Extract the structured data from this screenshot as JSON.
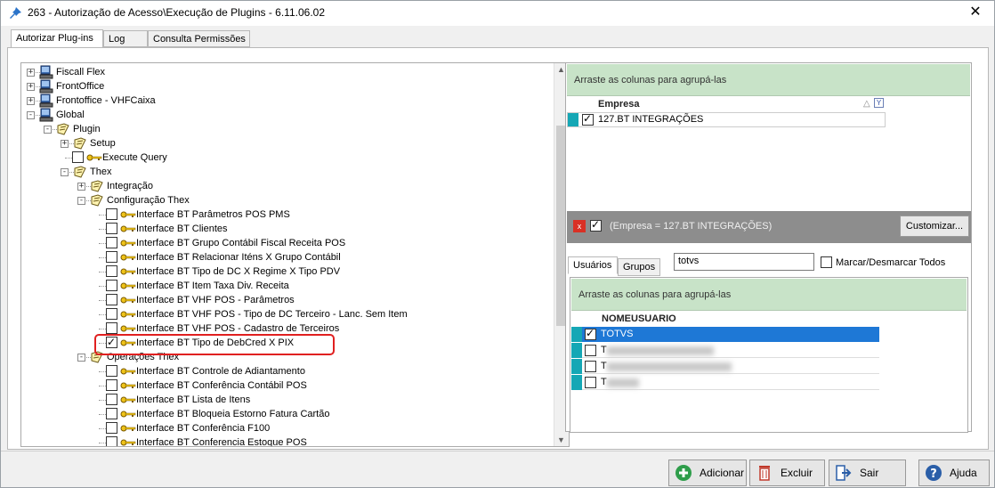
{
  "window": {
    "title": "263 - Autorização de Acesso\\Execução de Plugins - 6.11.06.02",
    "close_glyph": "✕"
  },
  "tabs": [
    "Autorizar Plug-ins",
    "Log",
    "Consulta Permissões"
  ],
  "tree": {
    "nodes": [
      {
        "label": "Fiscall Flex",
        "type": "server"
      },
      {
        "label": "FrontOffice",
        "type": "server"
      },
      {
        "label": "Frontoffice - VHFCaixa",
        "type": "server"
      },
      {
        "label": "Global",
        "type": "server"
      },
      {
        "label": "Plugin",
        "type": "folder"
      },
      {
        "label": "Setup",
        "type": "folder"
      },
      {
        "label": "Execute Query",
        "type": "item",
        "checked": false
      },
      {
        "label": "Thex",
        "type": "folder"
      },
      {
        "label": "Integração",
        "type": "folder"
      },
      {
        "label": "Configuração Thex",
        "type": "folder"
      },
      {
        "label": "Interface BT Parâmetros POS PMS",
        "type": "item",
        "checked": false
      },
      {
        "label": "Interface BT Clientes",
        "type": "item",
        "checked": false
      },
      {
        "label": "Interface BT Grupo Contábil Fiscal Receita POS",
        "type": "item",
        "checked": false
      },
      {
        "label": "Interface BT Relacionar Iténs X Grupo Contábil",
        "type": "item",
        "checked": false
      },
      {
        "label": "Interface BT Tipo de DC X Regime X Tipo PDV",
        "type": "item",
        "checked": false
      },
      {
        "label": "Interface BT Item Taxa Div. Receita",
        "type": "item",
        "checked": false
      },
      {
        "label": "Interface BT VHF POS - Parâmetros",
        "type": "item",
        "checked": false
      },
      {
        "label": "Interface BT VHF POS - Tipo de DC Terceiro - Lanc. Sem Item",
        "type": "item",
        "checked": false
      },
      {
        "label": "Interface BT VHF POS - Cadastro de Terceiros",
        "type": "item",
        "checked": false
      },
      {
        "label": "Interface BT Tipo de DebCred X PIX",
        "type": "item",
        "checked": true
      },
      {
        "label": "Operações Thex",
        "type": "folder"
      },
      {
        "label": "Interface BT Controle de Adiantamento",
        "type": "item",
        "checked": false
      },
      {
        "label": "Interface BT Conferência Contábil POS",
        "type": "item",
        "checked": false
      },
      {
        "label": "Interface BT Lista de Itens",
        "type": "item",
        "checked": false
      },
      {
        "label": "Interface BT Bloqueia Estorno Fatura Cartão",
        "type": "item",
        "checked": false
      },
      {
        "label": "Interface BT Conferência F100",
        "type": "item",
        "checked": false
      },
      {
        "label": "Interface BT Conferencia Estoque POS",
        "type": "item",
        "checked": false
      }
    ]
  },
  "company_grid": {
    "group_hint": "Arraste as colunas para agrupá-las",
    "column": "Empresa",
    "rows": [
      "127.BT INTEGRAÇÕES"
    ],
    "filter_text": "(Empresa = 127.BT INTEGRAÇÕES)",
    "filter_close": "x",
    "customize_label": "Customizar..."
  },
  "users": {
    "tabs": [
      "Usuários",
      "Grupos"
    ],
    "search_value": "totvs",
    "mark_all_label": "Marcar/Desmarcar Todos",
    "group_hint": "Arraste as colunas para agrupá-las",
    "column": "NOMEUSUARIO",
    "rows": [
      "TOTVS",
      "T",
      "T",
      "T"
    ]
  },
  "buttons": {
    "add": "Adicionar",
    "delete": "Excluir",
    "exit": "Sair",
    "help": "Ajuda"
  },
  "colors": {
    "group_hint_bg": "#c8e3c8",
    "row_indicator": "#15a7b5",
    "selected_row": "#1e78d6",
    "highlight": "#e02020"
  }
}
